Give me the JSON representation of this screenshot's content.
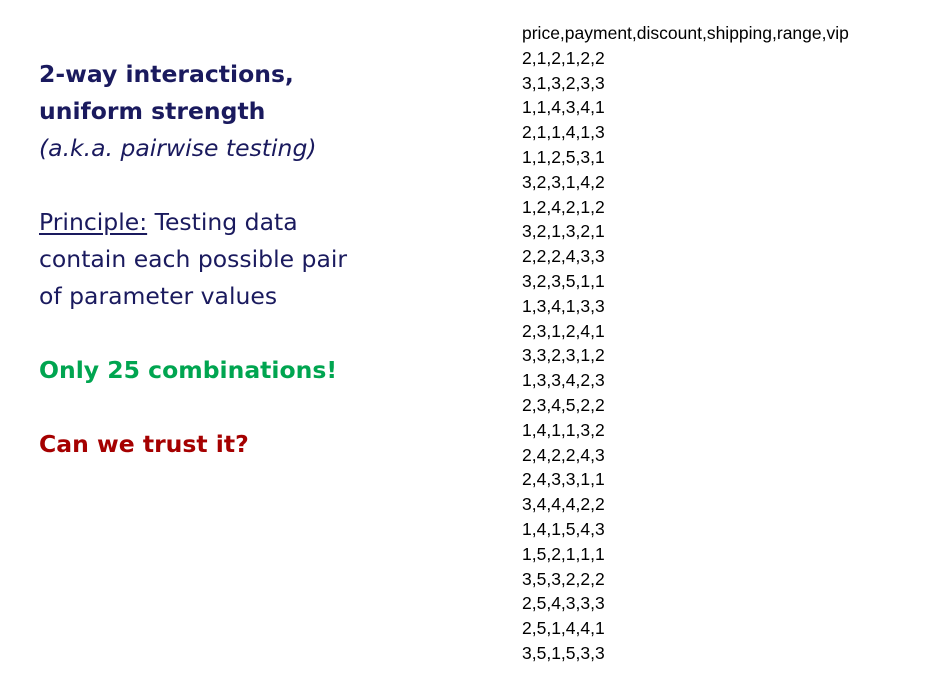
{
  "slide": {
    "heading_line1": "2-way interactions,",
    "heading_line2": "uniform strength",
    "subheading": "(a.k.a. pairwise testing)",
    "principle_label": "Principle:",
    "principle_text_1": " Testing data",
    "principle_text_2": "contain each possible pair",
    "principle_text_3": "of parameter values",
    "combinations_note": "Only 25 combinations!",
    "question": "Can we trust it?"
  },
  "csv": {
    "header": "price,payment,discount,shipping,range,vip",
    "rows": [
      "2,1,2,1,2,2",
      "3,1,3,2,3,3",
      "1,1,4,3,4,1",
      "2,1,1,4,1,3",
      "1,1,2,5,3,1",
      "3,2,3,1,4,2",
      "1,2,4,2,1,2",
      "3,2,1,3,2,1",
      "2,2,2,4,3,3",
      "3,2,3,5,1,1",
      "1,3,4,1,3,3",
      "2,3,1,2,4,1",
      "3,3,2,3,1,2",
      "1,3,3,4,2,3",
      "2,3,4,5,2,2",
      "1,4,1,1,3,2",
      "2,4,2,2,4,3",
      "2,4,3,3,1,1",
      "3,4,4,4,2,2",
      "1,4,1,5,4,3",
      "1,5,2,1,1,1",
      "3,5,3,2,2,2",
      "2,5,4,3,3,3",
      "2,5,1,4,4,1",
      "3,5,1,5,3,3"
    ]
  }
}
